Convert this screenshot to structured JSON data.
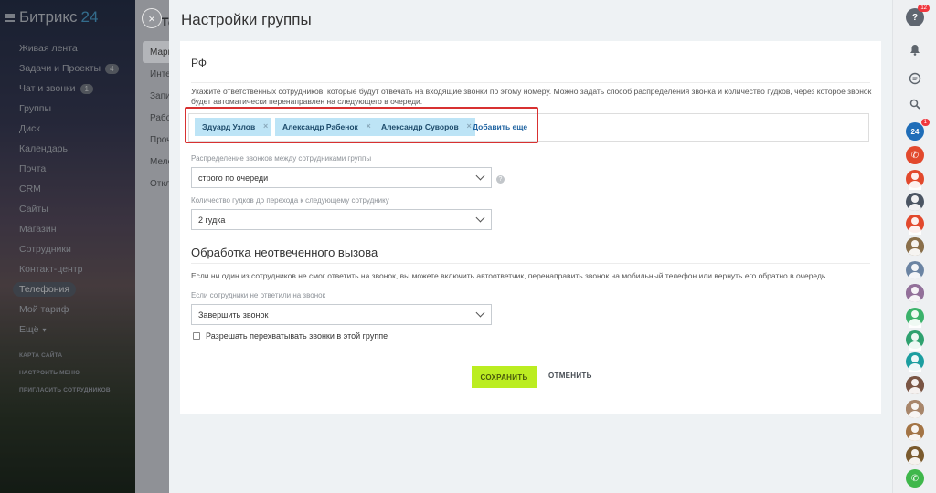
{
  "sidebar": {
    "logo": "Битрикс",
    "logo_num": "24",
    "items": [
      {
        "label": "Живая лента"
      },
      {
        "label": "Задачи и Проекты",
        "count": "4"
      },
      {
        "label": "Чат и звонки",
        "count": "1"
      },
      {
        "label": "Группы"
      },
      {
        "label": "Диск"
      },
      {
        "label": "Календарь"
      },
      {
        "label": "Почта"
      },
      {
        "label": "CRM"
      },
      {
        "label": "Сайты"
      },
      {
        "label": "Магазин"
      },
      {
        "label": "Сотрудники"
      },
      {
        "label": "Контакт-центр"
      },
      {
        "label": "Телефония",
        "active": true
      },
      {
        "label": "Мой тариф"
      },
      {
        "label": "Ещё"
      }
    ],
    "small_items": [
      "КАРТА САЙТА",
      "НАСТРОИТЬ МЕНЮ",
      "ПРИГЛАСИТЬ СОТРУДНИКОВ"
    ]
  },
  "underpage": {
    "title": "Тел",
    "tabs": [
      "Марш",
      "Инте",
      "Запи",
      "Рабо",
      "Проч",
      "Мело",
      "Откл"
    ]
  },
  "close_label": "×",
  "slider": {
    "title": "Настройки группы",
    "group_name": "РФ",
    "description": "Укажите ответственных сотрудников, которые будут отвечать на входящие звонки по этому номеру. Можно задать способ распределения звонка и количество гудков, через которое звонок будет автоматически перенаправлен на следующего в очереди.",
    "users": [
      "Эдуард Узлов",
      "Александр Рабенок",
      "Александр Суворов"
    ],
    "add_more": "Добавить еще",
    "distribution_label": "Распределение звонков между сотрудниками группы",
    "distribution_value": "строго по очереди",
    "rings_label": "Количество гудков до перехода к следующему сотруднику",
    "rings_value": "2 гудка",
    "unanswered_title": "Обработка неотвеченного вызова",
    "unanswered_desc": "Если ни один из сотрудников не смог ответить на звонок, вы можете включить автоответчик, перенаправить звонок на мобильный телефон или вернуть его обратно в очередь.",
    "no_answer_label": "Если сотрудники не ответили на звонок",
    "no_answer_value": "Завершить звонок",
    "intercept_label": "Разрешать перехватывать звонки в этой группе",
    "save": "СОХРАНИТЬ",
    "cancel": "ОТМЕНИТЬ",
    "help": "?"
  },
  "rightbar": {
    "help_badge": "12",
    "b24_label": "24",
    "b24_badge": "1"
  },
  "colors": {
    "accent_green": "#bbed21",
    "chip_blue": "#bde4f6",
    "highlight_red": "#d83131"
  }
}
